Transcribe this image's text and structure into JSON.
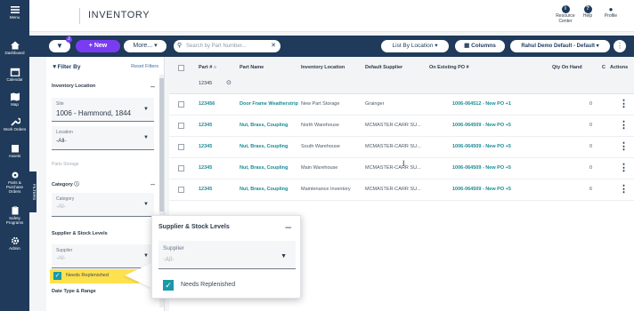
{
  "nav": {
    "items": [
      {
        "label": "Menu",
        "icon": "menu-icon"
      },
      {
        "label": "Dashboard",
        "icon": "home-icon"
      },
      {
        "label": "Calendar",
        "icon": "calendar-icon"
      },
      {
        "label": "Map",
        "icon": "map-icon"
      },
      {
        "label": "Work Orders",
        "icon": "wrench-icon"
      },
      {
        "label": "Assets",
        "icon": "building-icon"
      },
      {
        "label": "Parts & Purchase Orders",
        "icon": "parts-icon"
      },
      {
        "label": "Safety Programs",
        "icon": "clipboard-icon"
      },
      {
        "label": "Admin",
        "icon": "gear-icon"
      }
    ]
  },
  "header": {
    "title": "INVENTORY",
    "resource_center": "Resource Center",
    "help": "Help",
    "profile": "Profile"
  },
  "toolbar": {
    "filter_badge": "2",
    "new_label": "+ New",
    "more_label": "More...",
    "search_placeholder": "Search by Part Number...",
    "list_by": "List By Location",
    "columns": "Columns",
    "view": "Rahul Demo Default - Default"
  },
  "filters": {
    "heading": "Filter By",
    "reset": "Reset Filters",
    "side_tab": "FILTERS",
    "inventory_location": {
      "title": "Inventory Location",
      "site_label": "Site",
      "site_value": "1006 - Hammond, 1844",
      "location_label": "Location",
      "location_value": "-All-",
      "parts_storage": "Parts Storage"
    },
    "category": {
      "title": "Category",
      "label": "Category",
      "value": "-All-"
    },
    "supplier": {
      "title": "Supplier & Stock Levels",
      "label": "Supplier",
      "value": "-All-",
      "needs_replenished": "Needs Replenished"
    },
    "date_type": "Date Type & Range"
  },
  "popup": {
    "title": "Supplier & Stock Levels",
    "supplier_label": "Supplier",
    "supplier_value": "-All-",
    "needs_replenished": "Needs Replenished"
  },
  "table": {
    "headers": [
      "Part #",
      "Part Name",
      "Inventory Location",
      "Default Supplier",
      "On Existing PO #",
      "Qty On Hand",
      "C",
      "Actions"
    ],
    "part_filter_value": "12345",
    "rows": [
      {
        "part": "123456",
        "name": "Door Frame Weatherstrip",
        "location": "New Part Storage",
        "supplier": "Grainger",
        "po": "1006-064512 - New PO +1",
        "qty": "0"
      },
      {
        "part": "12345",
        "name": "Nut, Brass, Coupling",
        "location": "North Warehouse",
        "supplier": "MCMASTER-CARR SU...",
        "po": "1006-064509 - New PO +5",
        "qty": "0"
      },
      {
        "part": "12345",
        "name": "Nut, Brass, Coupling",
        "location": "South Warehouse",
        "supplier": "MCMASTER-CARR SU...",
        "po": "1006-064509 - New PO +5",
        "qty": "0"
      },
      {
        "part": "12345",
        "name": "Nut, Brass, Coupling",
        "location": "Main Warehouse",
        "supplier": "MCMASTER-CARR SU...",
        "po": "1006-064509 - New PO +5",
        "qty": "0"
      },
      {
        "part": "12345",
        "name": "Nut, Brass, Coupling",
        "location": "Maintenance Inventory",
        "supplier": "MCMASTER-CARR SU...",
        "po": "1006-064509 - New PO +5",
        "qty": "6"
      }
    ]
  },
  "colors": {
    "navy": "#1f3a5a",
    "purple": "#7a3cf2",
    "teal": "#1a8a96",
    "highlight": "#ffe14d"
  }
}
